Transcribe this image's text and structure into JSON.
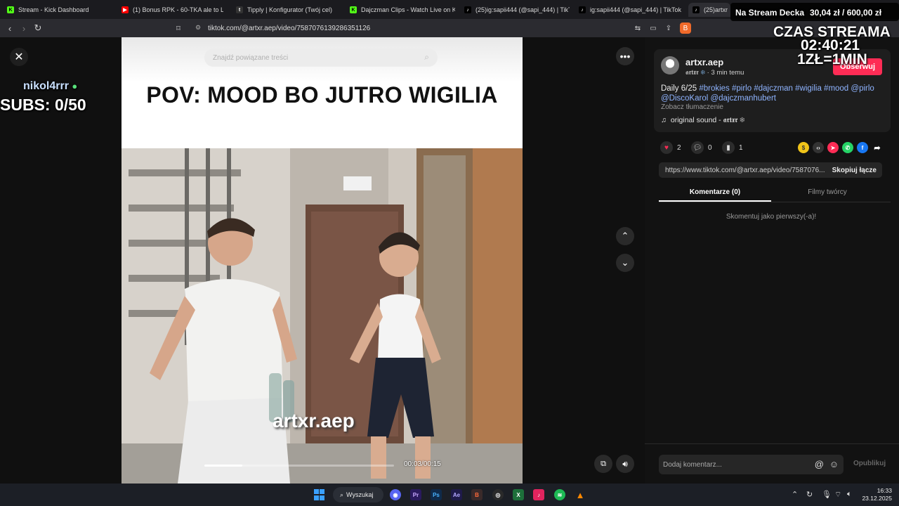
{
  "browser": {
    "tabs": [
      {
        "title": "Stream - Kick Dashboard",
        "icon": "kick-icon",
        "color": "#53fc18"
      },
      {
        "title": "(1) Bonus RPK - 60-TKA ale to LAST",
        "icon": "youtube-icon",
        "color": "#ff0000"
      },
      {
        "title": "Tipply | Konfigurator (Twój cel)",
        "icon": "tipply-icon",
        "color": "#ffffff"
      },
      {
        "title": "Dajczman Clips - Watch Live on Kick",
        "icon": "kick-icon",
        "color": "#53fc18"
      },
      {
        "title": "(25)ig:sapii444 (@sapi_444) | TikTok",
        "icon": "tiktok-icon",
        "color": "#ffffff"
      },
      {
        "title": "ig:sapii444 (@sapi_444) | TikTok",
        "icon": "tiktok-icon",
        "color": "#ffffff"
      },
      {
        "title": "(25)artxr",
        "icon": "tiktok-icon",
        "color": "#ffffff"
      }
    ],
    "url": "tiktok.com/@artxr.aep/video/7587076139286351126"
  },
  "overlay": {
    "username": "nikol4rrr",
    "subs": "SUBS: 0/50",
    "stream_deck_label": "Na Stream Decka",
    "goal": "30,04 zł / 600,00 zł",
    "czas_label": "CZAS STREAMA",
    "timer": "02:40:21",
    "rate": "1ZŁ=1MIN"
  },
  "video": {
    "search_placeholder": "Znajdź powiązane treści",
    "caption": "POV: MOOD BO JUTRO WIGILIA",
    "watermark": "artxr.aep",
    "time": "00:03/00:15",
    "progress": 0.2
  },
  "panel": {
    "username": "artxr.aep",
    "nickname": "𝖆𝖗𝖙𝖝𝖗",
    "snowflake": "❄",
    "posted": "3 min temu",
    "follow_label": "Obserwuj",
    "description_prefix": "Daily 6/25 ",
    "hashtags": "#brokies #pirlo #dajczman #wigilia #mood @pirlo @DiscoKarol @dajczmanhubert",
    "translate_label": "Zobacz tłumaczenie",
    "sound": "original sound - 𝖆𝖗𝖙𝖝𝖗 ❄",
    "likes": "2",
    "comments": "0",
    "saves": "1",
    "link": "https://www.tiktok.com/@artxr.aep/video/7587076...",
    "copy_label": "Skopiuj łącze",
    "tab_comments": "Komentarze (0)",
    "tab_creator": "Filmy twórcy",
    "empty_comments": "Skomentuj jako pierwszy(-a)!",
    "comment_placeholder": "Dodaj komentarz...",
    "publish_label": "Opublikuj"
  },
  "taskbar": {
    "search_label": "Wyszukaj",
    "time": "16:33",
    "date": "23.12.2025"
  },
  "colors": {
    "accent": "#fe2c55",
    "link": "#8fb4ff"
  }
}
